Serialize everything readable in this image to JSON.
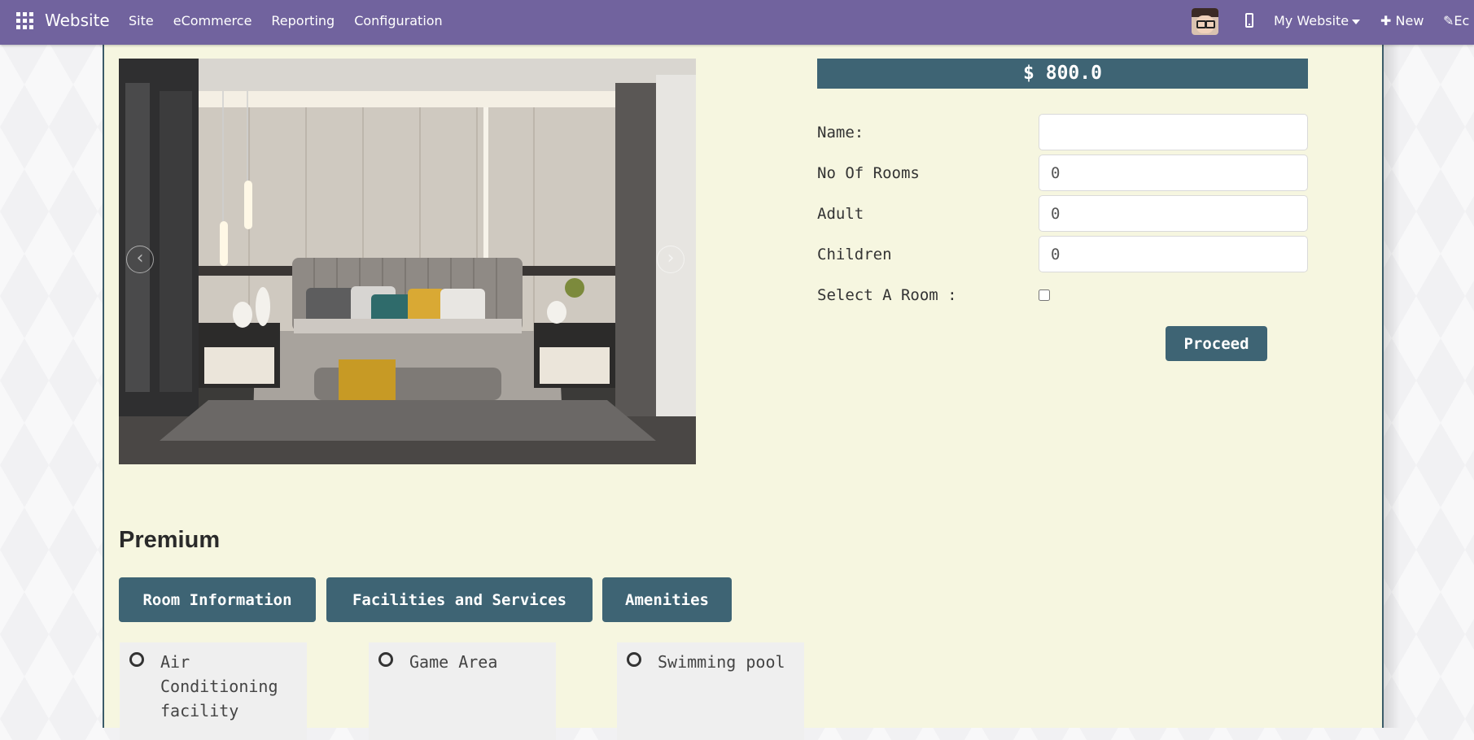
{
  "navbar": {
    "brand": "Website",
    "menu": [
      "Site",
      "eCommerce",
      "Reporting",
      "Configuration"
    ],
    "site_selector": "My Website",
    "new_label": "New",
    "edit_label": "Ec"
  },
  "booking": {
    "price": "$ 800.0",
    "fields": [
      {
        "label": "Name:",
        "value": ""
      },
      {
        "label": "No Of Rooms",
        "value": "0"
      },
      {
        "label": "Adult",
        "value": "0"
      },
      {
        "label": "Children",
        "value": "0"
      }
    ],
    "select_room_label": "Select A Room :",
    "select_room_checked": false,
    "proceed_label": "Proceed"
  },
  "room": {
    "title": "Premium",
    "tabs": [
      "Room Information",
      "Facilities and Services",
      "Amenities"
    ],
    "facilities": [
      "Air Conditioning facility",
      "Game Area",
      "Swimming pool"
    ]
  },
  "colors": {
    "navbar": "#71639e",
    "accent": "#3e6474",
    "page_bg": "#f6f6e0"
  }
}
